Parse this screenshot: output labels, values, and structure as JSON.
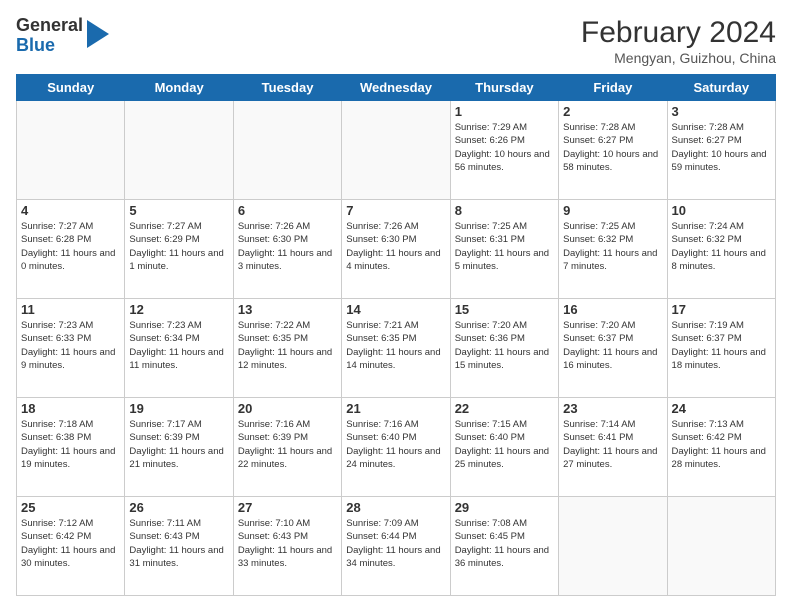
{
  "header": {
    "logo_general": "General",
    "logo_blue": "Blue",
    "month_year": "February 2024",
    "location": "Mengyan, Guizhou, China"
  },
  "days_of_week": [
    "Sunday",
    "Monday",
    "Tuesday",
    "Wednesday",
    "Thursday",
    "Friday",
    "Saturday"
  ],
  "weeks": [
    [
      {
        "day": "",
        "info": ""
      },
      {
        "day": "",
        "info": ""
      },
      {
        "day": "",
        "info": ""
      },
      {
        "day": "",
        "info": ""
      },
      {
        "day": "1",
        "info": "Sunrise: 7:29 AM\nSunset: 6:26 PM\nDaylight: 10 hours and 56 minutes."
      },
      {
        "day": "2",
        "info": "Sunrise: 7:28 AM\nSunset: 6:27 PM\nDaylight: 10 hours and 58 minutes."
      },
      {
        "day": "3",
        "info": "Sunrise: 7:28 AM\nSunset: 6:27 PM\nDaylight: 10 hours and 59 minutes."
      }
    ],
    [
      {
        "day": "4",
        "info": "Sunrise: 7:27 AM\nSunset: 6:28 PM\nDaylight: 11 hours and 0 minutes."
      },
      {
        "day": "5",
        "info": "Sunrise: 7:27 AM\nSunset: 6:29 PM\nDaylight: 11 hours and 1 minute."
      },
      {
        "day": "6",
        "info": "Sunrise: 7:26 AM\nSunset: 6:30 PM\nDaylight: 11 hours and 3 minutes."
      },
      {
        "day": "7",
        "info": "Sunrise: 7:26 AM\nSunset: 6:30 PM\nDaylight: 11 hours and 4 minutes."
      },
      {
        "day": "8",
        "info": "Sunrise: 7:25 AM\nSunset: 6:31 PM\nDaylight: 11 hours and 5 minutes."
      },
      {
        "day": "9",
        "info": "Sunrise: 7:25 AM\nSunset: 6:32 PM\nDaylight: 11 hours and 7 minutes."
      },
      {
        "day": "10",
        "info": "Sunrise: 7:24 AM\nSunset: 6:32 PM\nDaylight: 11 hours and 8 minutes."
      }
    ],
    [
      {
        "day": "11",
        "info": "Sunrise: 7:23 AM\nSunset: 6:33 PM\nDaylight: 11 hours and 9 minutes."
      },
      {
        "day": "12",
        "info": "Sunrise: 7:23 AM\nSunset: 6:34 PM\nDaylight: 11 hours and 11 minutes."
      },
      {
        "day": "13",
        "info": "Sunrise: 7:22 AM\nSunset: 6:35 PM\nDaylight: 11 hours and 12 minutes."
      },
      {
        "day": "14",
        "info": "Sunrise: 7:21 AM\nSunset: 6:35 PM\nDaylight: 11 hours and 14 minutes."
      },
      {
        "day": "15",
        "info": "Sunrise: 7:20 AM\nSunset: 6:36 PM\nDaylight: 11 hours and 15 minutes."
      },
      {
        "day": "16",
        "info": "Sunrise: 7:20 AM\nSunset: 6:37 PM\nDaylight: 11 hours and 16 minutes."
      },
      {
        "day": "17",
        "info": "Sunrise: 7:19 AM\nSunset: 6:37 PM\nDaylight: 11 hours and 18 minutes."
      }
    ],
    [
      {
        "day": "18",
        "info": "Sunrise: 7:18 AM\nSunset: 6:38 PM\nDaylight: 11 hours and 19 minutes."
      },
      {
        "day": "19",
        "info": "Sunrise: 7:17 AM\nSunset: 6:39 PM\nDaylight: 11 hours and 21 minutes."
      },
      {
        "day": "20",
        "info": "Sunrise: 7:16 AM\nSunset: 6:39 PM\nDaylight: 11 hours and 22 minutes."
      },
      {
        "day": "21",
        "info": "Sunrise: 7:16 AM\nSunset: 6:40 PM\nDaylight: 11 hours and 24 minutes."
      },
      {
        "day": "22",
        "info": "Sunrise: 7:15 AM\nSunset: 6:40 PM\nDaylight: 11 hours and 25 minutes."
      },
      {
        "day": "23",
        "info": "Sunrise: 7:14 AM\nSunset: 6:41 PM\nDaylight: 11 hours and 27 minutes."
      },
      {
        "day": "24",
        "info": "Sunrise: 7:13 AM\nSunset: 6:42 PM\nDaylight: 11 hours and 28 minutes."
      }
    ],
    [
      {
        "day": "25",
        "info": "Sunrise: 7:12 AM\nSunset: 6:42 PM\nDaylight: 11 hours and 30 minutes."
      },
      {
        "day": "26",
        "info": "Sunrise: 7:11 AM\nSunset: 6:43 PM\nDaylight: 11 hours and 31 minutes."
      },
      {
        "day": "27",
        "info": "Sunrise: 7:10 AM\nSunset: 6:43 PM\nDaylight: 11 hours and 33 minutes."
      },
      {
        "day": "28",
        "info": "Sunrise: 7:09 AM\nSunset: 6:44 PM\nDaylight: 11 hours and 34 minutes."
      },
      {
        "day": "29",
        "info": "Sunrise: 7:08 AM\nSunset: 6:45 PM\nDaylight: 11 hours and 36 minutes."
      },
      {
        "day": "",
        "info": ""
      },
      {
        "day": "",
        "info": ""
      }
    ]
  ]
}
